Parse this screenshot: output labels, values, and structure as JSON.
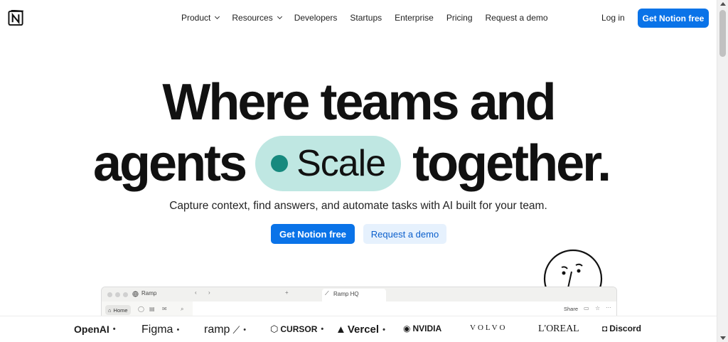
{
  "nav": {
    "logo": "N",
    "links": [
      "Product",
      "Resources",
      "Developers",
      "Startups",
      "Enterprise",
      "Pricing",
      "Request a demo"
    ],
    "login": "Log in",
    "cta": "Get Notion free"
  },
  "hero": {
    "line1": "Where teams and",
    "line2_start": "agents",
    "highlight_word": "Scale",
    "line2_end": "together.",
    "subtitle": "Capture context, find answers, and automate tasks with AI built for your team.",
    "primary_button": "Get Notion free",
    "secondary_button": "Request a demo"
  },
  "mockup": {
    "workspace": "Ramp",
    "tab_title": "Ramp HQ",
    "home": "Home",
    "share": "Share"
  },
  "logos": [
    "OpenAI",
    "Figma",
    "ramp",
    "CURSOR",
    "Vercel",
    "NVIDIA",
    "VOLVO",
    "L'OREAL",
    "Discord"
  ],
  "colors": {
    "accent": "#0a73e8",
    "highlight_pill": "#bfe7e2",
    "highlight_dot": "#17897e",
    "secondary_button_bg": "#e6f1fd"
  }
}
